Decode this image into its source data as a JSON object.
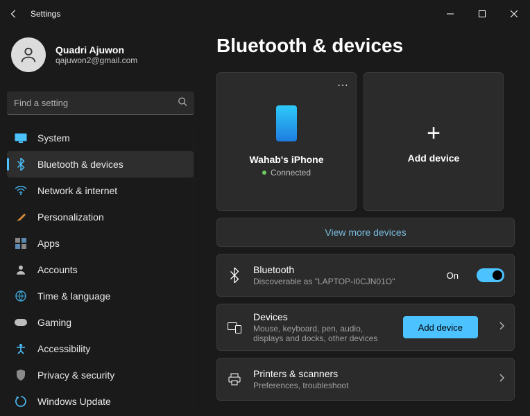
{
  "window": {
    "title": "Settings"
  },
  "user": {
    "name": "Quadri Ajuwon",
    "email": "qajuwon2@gmail.com"
  },
  "search": {
    "placeholder": "Find a setting"
  },
  "nav": [
    {
      "id": "system",
      "label": "System",
      "icon": "display-icon",
      "color": "#4cc2ff",
      "active": false
    },
    {
      "id": "bluetooth",
      "label": "Bluetooth & devices",
      "icon": "bluetooth-icon",
      "color": "#4cc2ff",
      "active": true
    },
    {
      "id": "network",
      "label": "Network & internet",
      "icon": "wifi-icon",
      "color": "#3fa6d6",
      "active": false
    },
    {
      "id": "personalization",
      "label": "Personalization",
      "icon": "brush-icon",
      "color": "#d68b3a",
      "active": false
    },
    {
      "id": "apps",
      "label": "Apps",
      "icon": "apps-icon",
      "color": "#888888",
      "active": false
    },
    {
      "id": "accounts",
      "label": "Accounts",
      "icon": "person-icon",
      "color": "#bdbdbd",
      "active": false
    },
    {
      "id": "time",
      "label": "Time & language",
      "icon": "globe-icon",
      "color": "#3fa6d6",
      "active": false
    },
    {
      "id": "gaming",
      "label": "Gaming",
      "icon": "gamepad-icon",
      "color": "#bdbdbd",
      "active": false
    },
    {
      "id": "accessibility",
      "label": "Accessibility",
      "icon": "accessibility-icon",
      "color": "#4cc2ff",
      "active": false
    },
    {
      "id": "privacy",
      "label": "Privacy & security",
      "icon": "shield-icon",
      "color": "#8a8a8a",
      "active": false
    },
    {
      "id": "update",
      "label": "Windows Update",
      "icon": "update-icon",
      "color": "#4cc2ff",
      "active": false
    }
  ],
  "page": {
    "title": "Bluetooth & devices",
    "paired_device": {
      "name": "Wahab's iPhone",
      "status": "Connected"
    },
    "add_device_label": "Add device",
    "view_more_label": "View more devices",
    "bluetooth_row": {
      "title": "Bluetooth",
      "subtitle": "Discoverable as \"LAPTOP-I0CJN01O\"",
      "state_label": "On",
      "state": true
    },
    "devices_row": {
      "title": "Devices",
      "subtitle": "Mouse, keyboard, pen, audio, displays and docks, other devices",
      "button_label": "Add device"
    },
    "printers_row": {
      "title": "Printers & scanners",
      "subtitle": "Preferences, troubleshoot"
    }
  },
  "colors": {
    "accent": "#4cc2ff",
    "link": "#7abfe0"
  }
}
